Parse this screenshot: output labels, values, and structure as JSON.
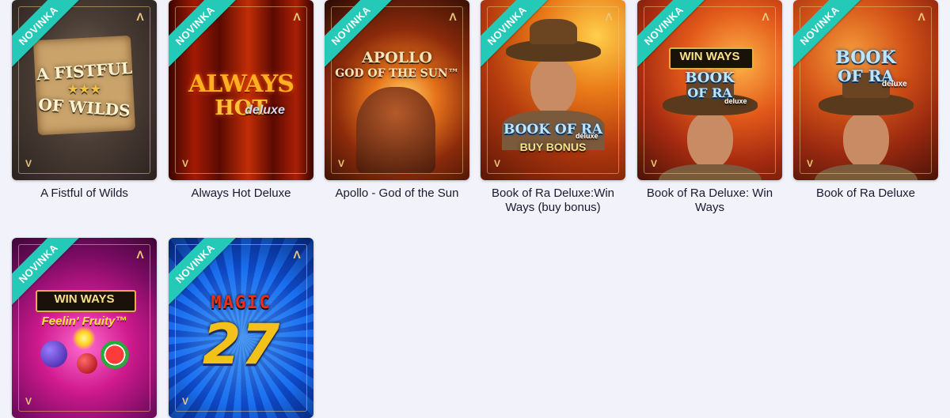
{
  "ribbon_label": "NOVINKA",
  "colors": {
    "ribbon": "#24c9b8",
    "page_background": "#f2f2fa",
    "title_text": "#1a1a2e"
  },
  "icons": {
    "top_right": "provider-logo-icon",
    "bottom_left": "provider-logo-icon"
  },
  "games": [
    {
      "title": "A Fistful of Wilds",
      "art_text": [
        "A FISTFUL",
        "★★★",
        "OF WILDS"
      ]
    },
    {
      "title": "Always Hot Deluxe",
      "art_text": [
        "ALWAYS",
        "HOT",
        "deluxe"
      ]
    },
    {
      "title": "Apollo - God of the Sun",
      "art_text": [
        "APOLLO",
        "GOD OF THE SUN™"
      ]
    },
    {
      "title": "Book of Ra Deluxe:Win Ways (buy bonus)",
      "art_text": [
        "BOOK OF RA",
        "deluxe",
        "BUY BONUS"
      ]
    },
    {
      "title": "Book of Ra Deluxe: Win Ways",
      "art_text": [
        "WIN WAYS",
        "BOOK",
        "OF RA",
        "deluxe"
      ]
    },
    {
      "title": "Book of Ra Deluxe",
      "art_text": [
        "BOOK",
        "OF RA",
        "deluxe"
      ]
    },
    {
      "title": "",
      "art_text": [
        "WIN WAYS",
        "Feelin' Fruity™"
      ]
    },
    {
      "title": "",
      "art_text": [
        "MAGIC",
        "27"
      ]
    }
  ]
}
